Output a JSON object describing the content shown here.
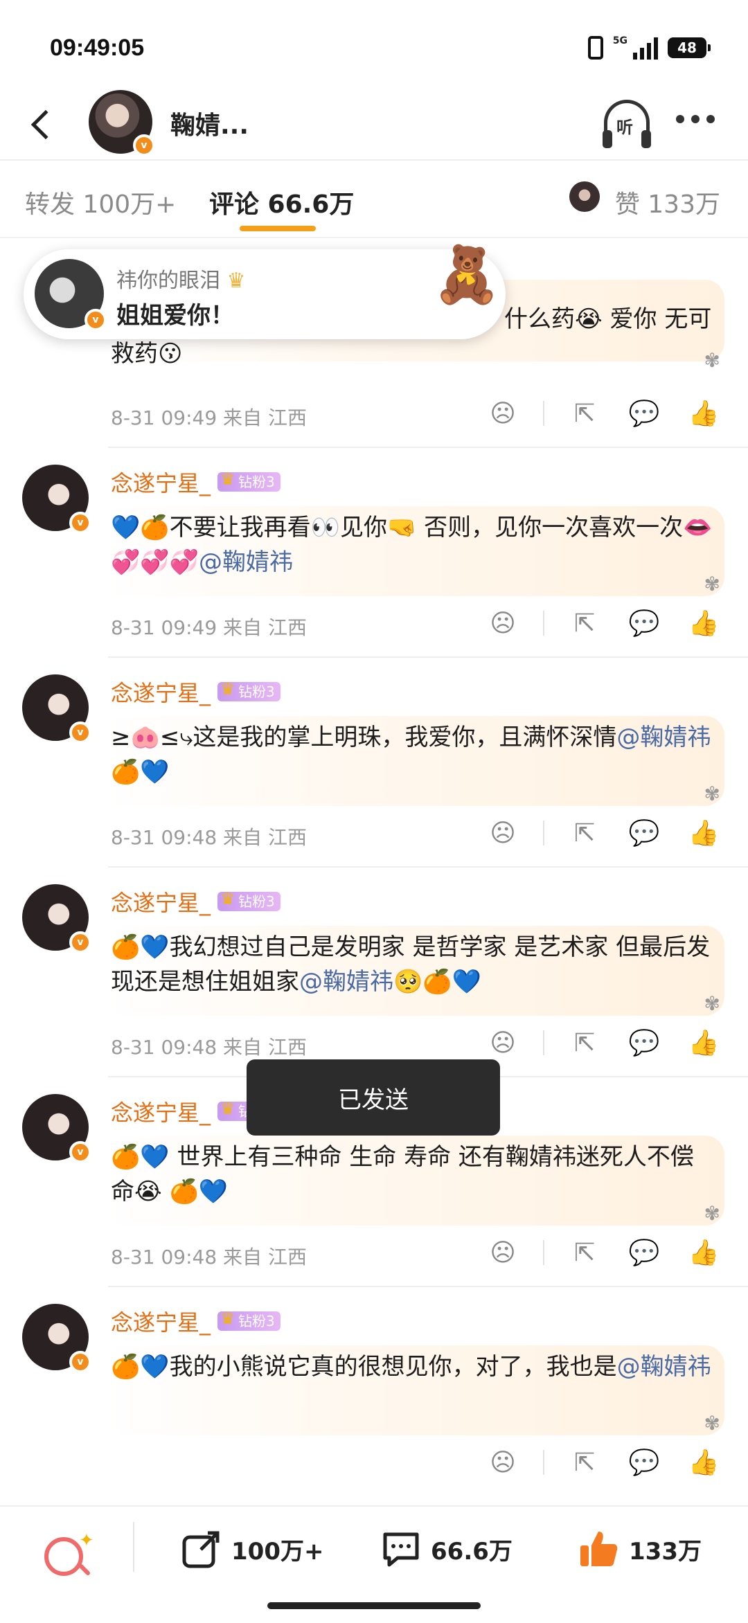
{
  "status_bar": {
    "time": "09:49:05",
    "network": "5G",
    "battery": "48"
  },
  "header": {
    "title": "鞠婧...",
    "listen_label": "听"
  },
  "tabs": {
    "repost": "转发 100万+",
    "comment": "评论 66.6万",
    "like": "赞 133万"
  },
  "popup": {
    "name": "祎你的眼泪",
    "message": "姐姐爱你！"
  },
  "comments": [
    {
      "name": "",
      "badge": "",
      "text": "什么药😭 爱你 无可救药😗",
      "meta": "8-31 09:49 来自 江西"
    },
    {
      "name": "念遂宁星_",
      "badge": "钻粉3",
      "text": "💙🍊不要让我再看👀见你🤜 否则，见你一次喜欢一次👄💞💞💞",
      "mention": "@鞠婧祎",
      "meta": "8-31 09:49 来自 江西"
    },
    {
      "name": "念遂宁星_",
      "badge": "钻粉3",
      "text": "≥🐽≤⤷这是我的掌上明珠，我爱你，且满怀深情",
      "mention": "@鞠婧祎",
      "text_after": "🍊💙",
      "meta": "8-31 09:48 来自 江西"
    },
    {
      "name": "念遂宁星_",
      "badge": "钻粉3",
      "text": "🍊💙我幻想过自己是发明家 是哲学家 是艺术家 但最后发现还是想住姐姐家",
      "mention": "@鞠婧祎",
      "text_after": "🥺🍊💙",
      "meta": "8-31 09:48 来自 江西"
    },
    {
      "name": "念遂宁星_",
      "badge": "钻粉3",
      "text": "🍊💙 世界上有三种命 生命 寿命 还有鞠婧祎迷死人不偿命😭 🍊💙",
      "meta": "8-31 09:48 来自 江西"
    },
    {
      "name": "念遂宁星_",
      "badge": "钻粉3",
      "text": "🍊💙我的小熊说它真的很想见你，对了，我也是",
      "mention": "@鞠婧祎",
      "meta": ""
    }
  ],
  "toast": "已发送",
  "bottom_bar": {
    "repost_count": "100万+",
    "comment_count": "66.6万",
    "like_count": "133万"
  },
  "colors": {
    "accent": "#f6a01a",
    "username": "#e36d12",
    "mention": "#4a6aa5",
    "verified": "#f28c1b"
  }
}
